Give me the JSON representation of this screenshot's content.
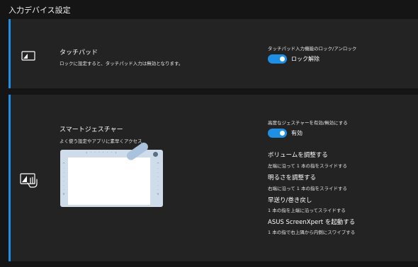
{
  "page_title": "入力デバイス設定",
  "touchpad": {
    "title": "タッチパッド",
    "description": "ロックに設定すると、タッチパッド入力は無効となります。",
    "setting_caption": "タッチパッド入力機能のロック/アンロック",
    "toggle_label": "ロック解除",
    "toggle_on": true
  },
  "smart_gesture": {
    "title": "スマートジェスチャー",
    "description": "よく使う設定やアプリに素早くアクセス",
    "setting_caption": "高度なジェスチャーを有効/無効にする",
    "toggle_label": "有効",
    "toggle_on": true,
    "gestures": [
      {
        "title": "ボリュームを調整する",
        "desc": "左端に沿って 1 本の指をスライドする"
      },
      {
        "title": "明るさを調整する",
        "desc": "右端に沿って 1 本の指をスライドする"
      },
      {
        "title": "早送り/巻き戻し",
        "desc": "1 本の指を上端に沿ってスライドする"
      },
      {
        "title": "ASUS ScreenXpert を起動する",
        "desc": "1 本の指で右上隅から内側にスワイプする"
      }
    ]
  },
  "colors": {
    "accent": "#1f8fe6",
    "card": "#232323",
    "background": "#151515"
  }
}
